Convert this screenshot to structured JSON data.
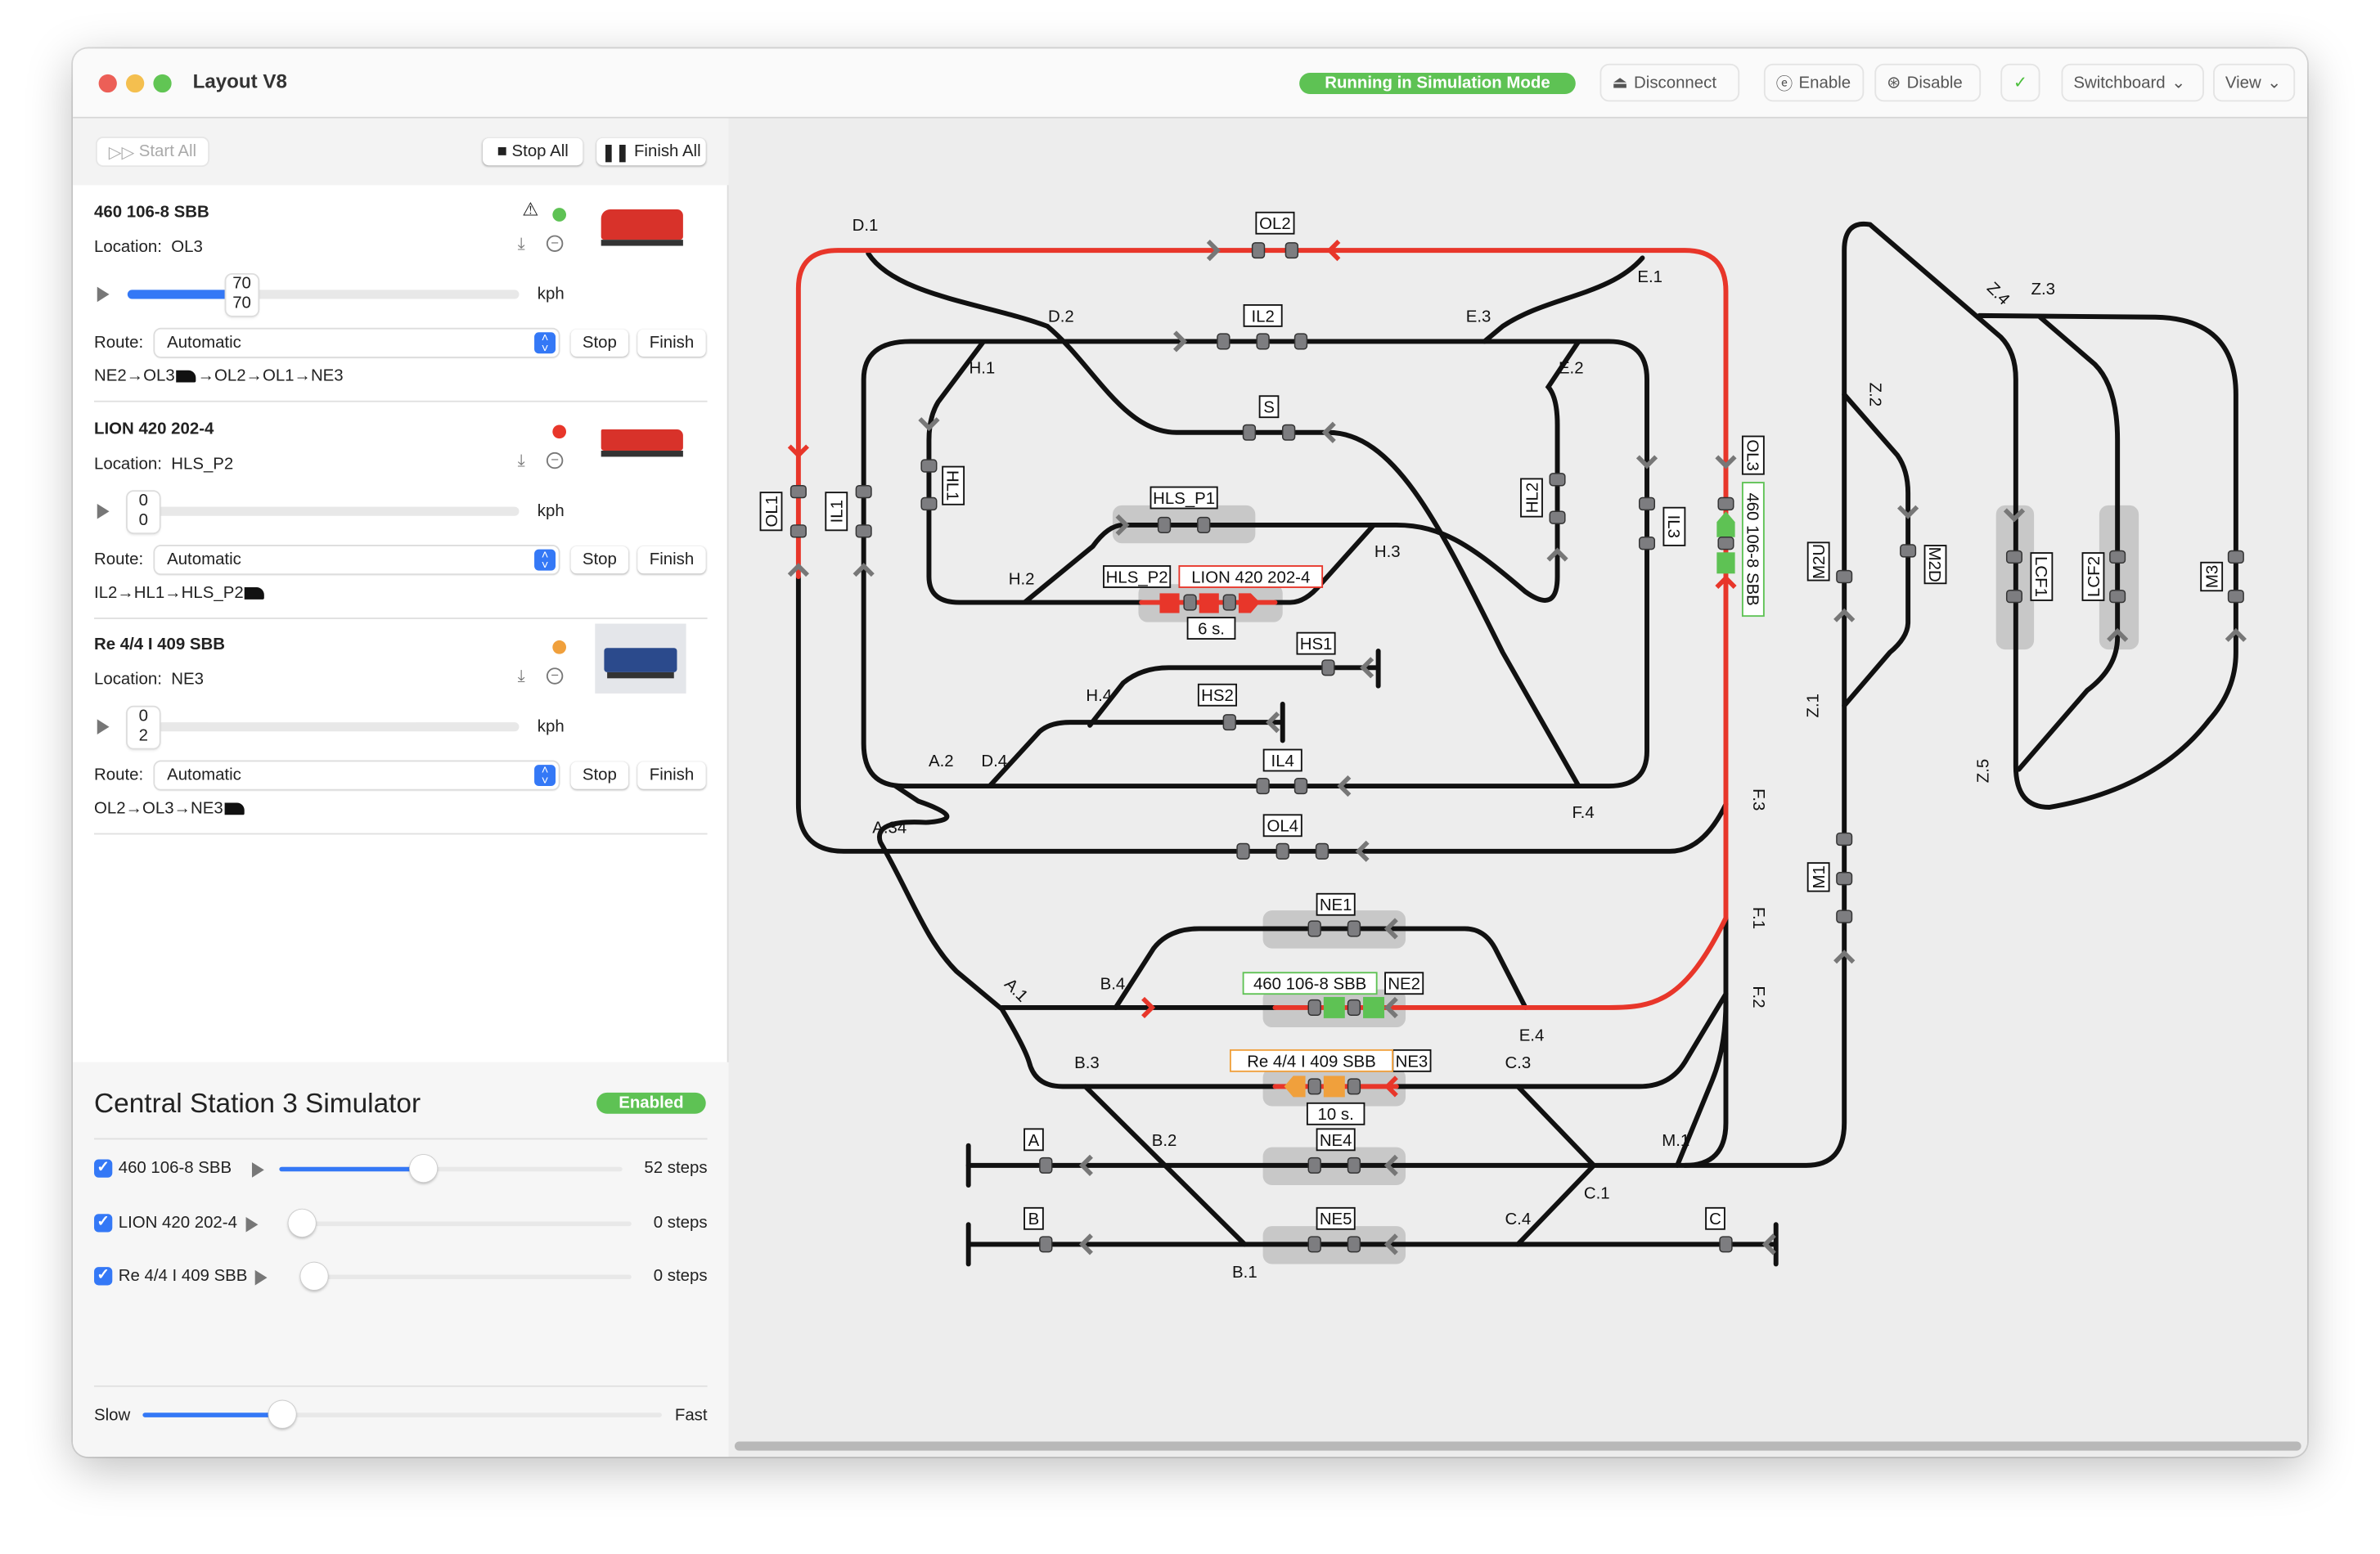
{
  "window": {
    "title": "Layout V8"
  },
  "toolbar": {
    "status": "Running in Simulation Mode",
    "disconnect": "Disconnect",
    "enable": "Enable",
    "disable": "Disable",
    "switchboard": "Switchboard",
    "view": "View"
  },
  "colors": {
    "accent": "#3478f6",
    "status_green": "#5ec254",
    "route_red": "#e8362a",
    "train_orange": "#f0a03c",
    "train_green": "#5ec254"
  },
  "controls": {
    "start_all": "Start All",
    "stop_all": "Stop All",
    "finish_all": "Finish All"
  },
  "trains": [
    {
      "name": "460 106-8 SBB",
      "location_label": "Location:",
      "location": "OL3",
      "status_color": "#5ec254",
      "warning": true,
      "speed_target": "70",
      "speed_actual": "70",
      "speed_fraction": 0.29,
      "unit": "kph",
      "route_label": "Route:",
      "route": "Automatic",
      "stop": "Stop",
      "finish": "Finish",
      "path": [
        "NE2→OL3",
        "→OL2→OL1→NE3"
      ],
      "path_icon_after": 0
    },
    {
      "name": "LION 420 202-4",
      "location_label": "Location:",
      "location": "HLS_P2",
      "status_color": "#e8362a",
      "warning": false,
      "speed_target": "0",
      "speed_actual": "0",
      "speed_fraction": 0,
      "unit": "kph",
      "route_label": "Route:",
      "route": "Automatic",
      "stop": "Stop",
      "finish": "Finish",
      "path": [
        "IL2→HL1→HLS_P2",
        ""
      ],
      "path_icon_after": 0
    },
    {
      "name": "Re 4/4 I 409 SBB",
      "location_label": "Location:",
      "location": "NE3",
      "status_color": "#f0a03c",
      "warning": false,
      "speed_target": "0",
      "speed_actual": "2",
      "speed_fraction": 0,
      "unit": "kph",
      "route_label": "Route:",
      "route": "Automatic",
      "stop": "Stop",
      "finish": "Finish",
      "path": [
        "OL2→OL3→NE3",
        ""
      ],
      "path_icon_after": 0
    }
  ],
  "simulator": {
    "title": "Central Station 3 Simulator",
    "status": "Enabled",
    "rows": [
      {
        "name": "460 106-8 SBB",
        "checked": true,
        "fraction": 0.42,
        "value": "52 steps"
      },
      {
        "name": "LION 420 202-4",
        "checked": true,
        "fraction": 0,
        "value": "0 steps"
      },
      {
        "name": "Re 4/4 I 409 SBB",
        "checked": true,
        "fraction": 0,
        "value": "0 steps"
      }
    ],
    "speed": {
      "min_label": "Slow",
      "max_label": "Fast",
      "fraction": 0.27
    }
  },
  "layout": {
    "blocks": [
      "OL1",
      "OL2",
      "OL3",
      "OL4",
      "IL1",
      "IL2",
      "IL3",
      "IL4",
      "HL1",
      "HL2",
      "S",
      "HLS_P1",
      "HLS_P2",
      "HS1",
      "HS2",
      "NE1",
      "NE2",
      "NE3",
      "NE4",
      "NE5",
      "A",
      "B",
      "C",
      "M1",
      "M2U",
      "M2D",
      "LCF1",
      "LCF2",
      "M3"
    ],
    "turnouts": [
      "D.1",
      "D.2",
      "E.1",
      "E.2",
      "E.3",
      "H.1",
      "H.2",
      "H.3",
      "H.4",
      "A.1",
      "A.2",
      "A.34",
      "D.4",
      "F.1",
      "F.2",
      "F.3",
      "F.4",
      "B.1",
      "B.2",
      "B.3",
      "B.4",
      "C.1",
      "C.3",
      "C.4",
      "E.4",
      "M.1",
      "Z.1",
      "Z.2",
      "Z.3",
      "Z.4",
      "Z.5"
    ],
    "train_labels": [
      {
        "block": "HLS_P2",
        "text": "LION 420 202-4",
        "color": "#e8362a"
      },
      {
        "block": "NE2",
        "text": "460 106-8 SBB",
        "color": "#5ec254"
      },
      {
        "block": "NE3",
        "text": "Re 4/4 I 409 SBB",
        "color": "#f0a03c"
      },
      {
        "block": "OL3",
        "text": "460 106-8 SBB",
        "color": "#5ec254"
      }
    ],
    "timers": [
      {
        "block": "HLS_P2",
        "text": "6 s."
      },
      {
        "block": "NE3",
        "text": "10 s."
      }
    ]
  }
}
